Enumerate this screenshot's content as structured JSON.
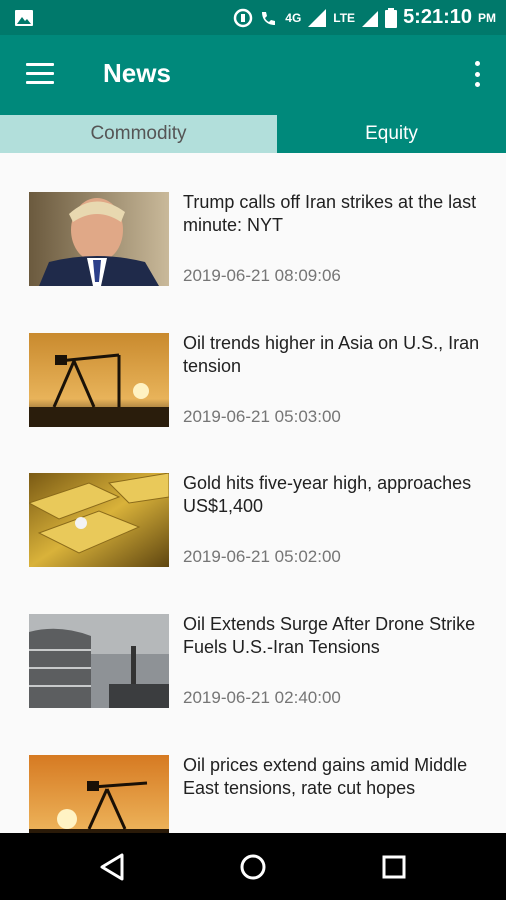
{
  "status_bar": {
    "network": "4G",
    "lte": "LTE",
    "time": "5:21:10",
    "ampm": "PM"
  },
  "app_bar": {
    "title": "News"
  },
  "tabs": [
    {
      "label": "Commodity",
      "selected": false
    },
    {
      "label": "Equity",
      "selected": true
    }
  ],
  "news": [
    {
      "headline": "Trump calls off Iran strikes at the last minute: NYT",
      "date": "2019-06-21 08:09:06"
    },
    {
      "headline": "Oil trends higher in Asia on U.S., Iran tension",
      "date": "2019-06-21 05:03:00"
    },
    {
      "headline": "Gold hits five-year high, approaches US$1,400",
      "date": "2019-06-21 05:02:00"
    },
    {
      "headline": "Oil Extends Surge After Drone Strike Fuels U.S.-Iran Tensions",
      "date": "2019-06-21 02:40:00"
    },
    {
      "headline": "Oil prices extend gains amid Middle East tensions, rate cut hopes",
      "date": ""
    }
  ],
  "colors": {
    "primary": "#00897b",
    "primary_dark": "#00796b",
    "tab_inactive": "#b2dfdb"
  }
}
